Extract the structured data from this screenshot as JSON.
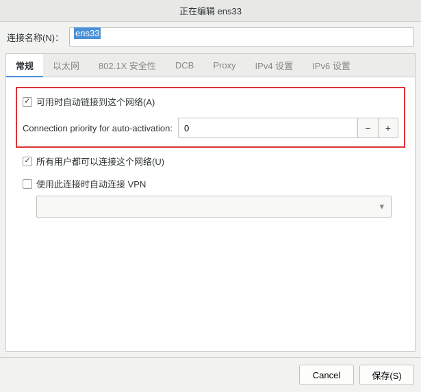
{
  "title": "正在编辑 ens33",
  "connection_name_label": "连接名称(N)：",
  "connection_name_value": "ens33",
  "tabs": {
    "general": "常规",
    "ethernet": "以太网",
    "security": "802.1X 安全性",
    "dcb": "DCB",
    "proxy": "Proxy",
    "ipv4": "IPv4 设置",
    "ipv6": "IPv6 设置"
  },
  "general": {
    "auto_connect_label": "可用时自动链接到这个网络(A)",
    "priority_label": "Connection priority for auto-activation:",
    "priority_value": "0",
    "all_users_label": "所有用户都可以连接这个网络(U)",
    "auto_vpn_label": "使用此连接时自动连接 VPN"
  },
  "buttons": {
    "cancel": "Cancel",
    "save": "保存(S)"
  },
  "icons": {
    "minus": "−",
    "plus": "+",
    "chevron_down": "▾"
  }
}
